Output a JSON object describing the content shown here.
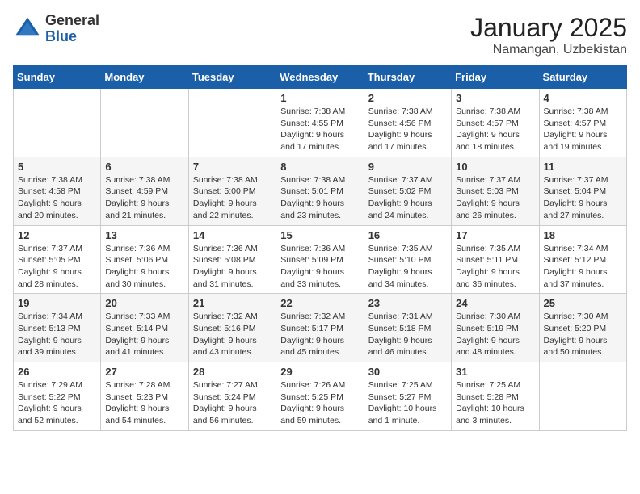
{
  "header": {
    "logo_general": "General",
    "logo_blue": "Blue",
    "month": "January 2025",
    "location": "Namangan, Uzbekistan"
  },
  "weekdays": [
    "Sunday",
    "Monday",
    "Tuesday",
    "Wednesday",
    "Thursday",
    "Friday",
    "Saturday"
  ],
  "weeks": [
    [
      {
        "day": "",
        "info": ""
      },
      {
        "day": "",
        "info": ""
      },
      {
        "day": "",
        "info": ""
      },
      {
        "day": "1",
        "info": "Sunrise: 7:38 AM\nSunset: 4:55 PM\nDaylight: 9 hours\nand 17 minutes."
      },
      {
        "day": "2",
        "info": "Sunrise: 7:38 AM\nSunset: 4:56 PM\nDaylight: 9 hours\nand 17 minutes."
      },
      {
        "day": "3",
        "info": "Sunrise: 7:38 AM\nSunset: 4:57 PM\nDaylight: 9 hours\nand 18 minutes."
      },
      {
        "day": "4",
        "info": "Sunrise: 7:38 AM\nSunset: 4:57 PM\nDaylight: 9 hours\nand 19 minutes."
      }
    ],
    [
      {
        "day": "5",
        "info": "Sunrise: 7:38 AM\nSunset: 4:58 PM\nDaylight: 9 hours\nand 20 minutes."
      },
      {
        "day": "6",
        "info": "Sunrise: 7:38 AM\nSunset: 4:59 PM\nDaylight: 9 hours\nand 21 minutes."
      },
      {
        "day": "7",
        "info": "Sunrise: 7:38 AM\nSunset: 5:00 PM\nDaylight: 9 hours\nand 22 minutes."
      },
      {
        "day": "8",
        "info": "Sunrise: 7:38 AM\nSunset: 5:01 PM\nDaylight: 9 hours\nand 23 minutes."
      },
      {
        "day": "9",
        "info": "Sunrise: 7:37 AM\nSunset: 5:02 PM\nDaylight: 9 hours\nand 24 minutes."
      },
      {
        "day": "10",
        "info": "Sunrise: 7:37 AM\nSunset: 5:03 PM\nDaylight: 9 hours\nand 26 minutes."
      },
      {
        "day": "11",
        "info": "Sunrise: 7:37 AM\nSunset: 5:04 PM\nDaylight: 9 hours\nand 27 minutes."
      }
    ],
    [
      {
        "day": "12",
        "info": "Sunrise: 7:37 AM\nSunset: 5:05 PM\nDaylight: 9 hours\nand 28 minutes."
      },
      {
        "day": "13",
        "info": "Sunrise: 7:36 AM\nSunset: 5:06 PM\nDaylight: 9 hours\nand 30 minutes."
      },
      {
        "day": "14",
        "info": "Sunrise: 7:36 AM\nSunset: 5:08 PM\nDaylight: 9 hours\nand 31 minutes."
      },
      {
        "day": "15",
        "info": "Sunrise: 7:36 AM\nSunset: 5:09 PM\nDaylight: 9 hours\nand 33 minutes."
      },
      {
        "day": "16",
        "info": "Sunrise: 7:35 AM\nSunset: 5:10 PM\nDaylight: 9 hours\nand 34 minutes."
      },
      {
        "day": "17",
        "info": "Sunrise: 7:35 AM\nSunset: 5:11 PM\nDaylight: 9 hours\nand 36 minutes."
      },
      {
        "day": "18",
        "info": "Sunrise: 7:34 AM\nSunset: 5:12 PM\nDaylight: 9 hours\nand 37 minutes."
      }
    ],
    [
      {
        "day": "19",
        "info": "Sunrise: 7:34 AM\nSunset: 5:13 PM\nDaylight: 9 hours\nand 39 minutes."
      },
      {
        "day": "20",
        "info": "Sunrise: 7:33 AM\nSunset: 5:14 PM\nDaylight: 9 hours\nand 41 minutes."
      },
      {
        "day": "21",
        "info": "Sunrise: 7:32 AM\nSunset: 5:16 PM\nDaylight: 9 hours\nand 43 minutes."
      },
      {
        "day": "22",
        "info": "Sunrise: 7:32 AM\nSunset: 5:17 PM\nDaylight: 9 hours\nand 45 minutes."
      },
      {
        "day": "23",
        "info": "Sunrise: 7:31 AM\nSunset: 5:18 PM\nDaylight: 9 hours\nand 46 minutes."
      },
      {
        "day": "24",
        "info": "Sunrise: 7:30 AM\nSunset: 5:19 PM\nDaylight: 9 hours\nand 48 minutes."
      },
      {
        "day": "25",
        "info": "Sunrise: 7:30 AM\nSunset: 5:20 PM\nDaylight: 9 hours\nand 50 minutes."
      }
    ],
    [
      {
        "day": "26",
        "info": "Sunrise: 7:29 AM\nSunset: 5:22 PM\nDaylight: 9 hours\nand 52 minutes."
      },
      {
        "day": "27",
        "info": "Sunrise: 7:28 AM\nSunset: 5:23 PM\nDaylight: 9 hours\nand 54 minutes."
      },
      {
        "day": "28",
        "info": "Sunrise: 7:27 AM\nSunset: 5:24 PM\nDaylight: 9 hours\nand 56 minutes."
      },
      {
        "day": "29",
        "info": "Sunrise: 7:26 AM\nSunset: 5:25 PM\nDaylight: 9 hours\nand 59 minutes."
      },
      {
        "day": "30",
        "info": "Sunrise: 7:25 AM\nSunset: 5:27 PM\nDaylight: 10 hours\nand 1 minute."
      },
      {
        "day": "31",
        "info": "Sunrise: 7:25 AM\nSunset: 5:28 PM\nDaylight: 10 hours\nand 3 minutes."
      },
      {
        "day": "",
        "info": ""
      }
    ]
  ]
}
